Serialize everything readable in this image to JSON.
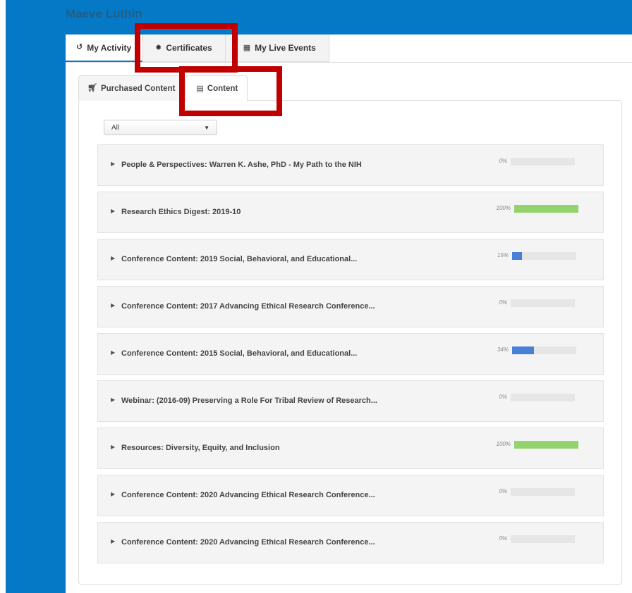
{
  "user": {
    "name": "Maeve Luthin"
  },
  "top_tabs": [
    {
      "label": "My Activity",
      "icon": "history-icon",
      "glyph": "↺",
      "active": true
    },
    {
      "label": "Certificates",
      "icon": "certificate-icon",
      "glyph": "✹",
      "active": false
    },
    {
      "label": "My Live Events",
      "icon": "calendar-icon",
      "glyph": "▦",
      "active": false
    }
  ],
  "sub_tabs": [
    {
      "label": "Purchased Content",
      "icon": "cart-icon",
      "glyph": "🛒",
      "active": false
    },
    {
      "label": "Content",
      "icon": "book-icon",
      "glyph": "▤",
      "active": true
    }
  ],
  "filter": {
    "selected": "All"
  },
  "items": [
    {
      "title": "People & Perspectives: Warren K. Ashe, PhD - My Path to the NIH",
      "progress_label": "0%",
      "progress": 0,
      "color": "#4a7fd6"
    },
    {
      "title": "Research Ethics Digest: 2019-10",
      "progress_label": "100%",
      "progress": 1.0,
      "color": "#92d36e"
    },
    {
      "title": "Conference Content: 2019 Social, Behavioral, and Educational...",
      "progress_label": "15%",
      "progress": 0.15,
      "color": "#4a7fd6"
    },
    {
      "title": "Conference Content: 2017 Advancing Ethical Research Conference...",
      "progress_label": "0%",
      "progress": 0,
      "color": "#4a7fd6"
    },
    {
      "title": "Conference Content: 2015 Social, Behavioral, and Educational...",
      "progress_label": "34%",
      "progress": 0.34,
      "color": "#4a7fd6"
    },
    {
      "title": "Webinar: (2016-09) Preserving a Role For Tribal Review of Research...",
      "progress_label": "0%",
      "progress": 0,
      "color": "#4a7fd6"
    },
    {
      "title": "Resources: Diversity, Equity, and Inclusion",
      "progress_label": "100%",
      "progress": 1.0,
      "color": "#92d36e"
    },
    {
      "title": "Conference Content: 2020 Advancing Ethical Research Conference...",
      "progress_label": "0%",
      "progress": 0,
      "color": "#4a7fd6"
    },
    {
      "title": "Conference Content: 2020 Advancing Ethical Research Conference...",
      "progress_label": "0%",
      "progress": 0,
      "color": "#4a7fd6"
    }
  ],
  "colors": {
    "header_blue": "#0579c6",
    "highlight_red": "#c00000"
  }
}
